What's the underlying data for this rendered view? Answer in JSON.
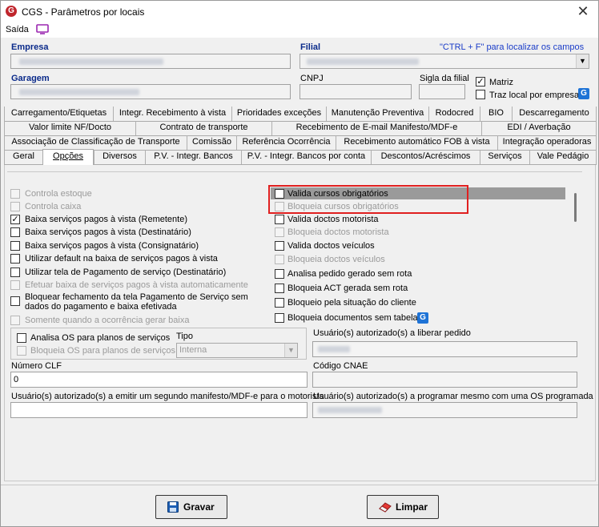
{
  "window": {
    "title": "CGS - Parâmetros por locais",
    "close_label": "✕"
  },
  "menu": {
    "exit_label": "Saída"
  },
  "header": {
    "empresa_label": "Empresa",
    "filial_label": "Filial",
    "ctrl_hint": "\"CTRL + F\" para localizar os campos",
    "garagem_label": "Garagem",
    "cnpj_label": "CNPJ",
    "sigla_label": "Sigla da filial",
    "matriz_label": "Matriz",
    "traz_local_label": "Traz local por empresa"
  },
  "tabs": {
    "row1": [
      "Carregamento/Etiquetas",
      "Integr. Recebimento à vista",
      "Prioridades exceções",
      "Manutenção Preventiva",
      "Rodocred",
      "BIO",
      "Descarregamento"
    ],
    "row2": [
      "Valor limite NF/Docto",
      "Contrato de transporte",
      "Recebimento de E-mail Manifesto/MDF-e",
      "EDI / Averbação"
    ],
    "row3": [
      "Associação de Classificação de Transporte",
      "Comissão",
      "Referência Ocorrência",
      "Recebimento automático FOB à vista",
      "Integração operadoras"
    ],
    "row4": [
      "Geral",
      "Opções",
      "Diversos",
      "P.V. - Integr. Bancos",
      "P.V. - Integr. Bancos por conta",
      "Descontos/Acréscimos",
      "Serviços",
      "Vale Pedágio"
    ]
  },
  "left_options": [
    {
      "label": "Controla estoque",
      "checked": false,
      "disabled": true
    },
    {
      "label": "Controla caixa",
      "checked": false,
      "disabled": true
    },
    {
      "label": "Baixa serviços pagos à vista (Remetente)",
      "checked": true,
      "disabled": false
    },
    {
      "label": "Baixa serviços pagos à vista (Destinatário)",
      "checked": false,
      "disabled": false
    },
    {
      "label": "Baixa serviços pagos à vista (Consignatário)",
      "checked": false,
      "disabled": false
    },
    {
      "label": "Utilizar default na baixa de serviços pagos à vista",
      "checked": false,
      "disabled": false
    },
    {
      "label": "Utilizar tela de Pagamento de serviço (Destinatário)",
      "checked": false,
      "disabled": false
    },
    {
      "label": "Efetuar baixa de serviços pagos à vista automaticamente",
      "checked": false,
      "disabled": true
    },
    {
      "label": "Bloquear fechamento da tela Pagamento de Serviço sem",
      "label2": "dados do pagamento e baixa efetivada",
      "checked": false,
      "disabled": false
    },
    {
      "label": "Somente quando a ocorrência gerar baixa",
      "checked": false,
      "disabled": true
    }
  ],
  "right_options": [
    {
      "label": "Valida cursos obrigatórios",
      "checked": false,
      "disabled": false,
      "selected": true
    },
    {
      "label": "Bloqueia cursos obrigatórios",
      "checked": false,
      "disabled": true
    },
    {
      "label": "Valida doctos motorista",
      "checked": false,
      "disabled": false
    },
    {
      "label": "Bloqueia doctos motorista",
      "checked": false,
      "disabled": true
    },
    {
      "label": "Valida doctos veículos",
      "checked": false,
      "disabled": false
    },
    {
      "label": "Bloqueia doctos veículos",
      "checked": false,
      "disabled": true
    },
    {
      "label": "Analisa pedido gerado sem rota",
      "checked": false,
      "disabled": false
    },
    {
      "label": "Bloqueia ACT gerada sem rota",
      "checked": false,
      "disabled": false
    },
    {
      "label": "Bloqueio pela situação do cliente",
      "checked": false,
      "disabled": false
    },
    {
      "label": "Bloqueia documentos sem tabela",
      "checked": false,
      "disabled": false
    }
  ],
  "os_group": {
    "analisa_label": "Analisa OS para planos de serviços",
    "bloqueia_label": "Bloqueia OS para planos de serviços",
    "tipo_label": "Tipo",
    "tipo_value": "Interna"
  },
  "fields": {
    "usuarios_liberar_label": "Usuário(s) autorizado(s) a liberar pedido",
    "numero_clf_label": "Número CLF",
    "numero_clf_value": "0",
    "codigo_cnae_label": "Código CNAE",
    "usuarios_manifesto_label": "Usuário(s) autorizado(s) a emitir um segundo manifesto/MDF-e para o motorista",
    "usuarios_os_label": "Usuário(s) autorizado(s) a programar mesmo com uma OS programada"
  },
  "buttons": {
    "gravar": "Gravar",
    "limpar": "Limpar"
  },
  "colors": {
    "title_accent": "#c0262d",
    "label_blue": "#0a2a8a",
    "link_blue": "#1a3cc8",
    "highlight_red": "#e02020",
    "selection_gray": "#9a9a9a"
  }
}
